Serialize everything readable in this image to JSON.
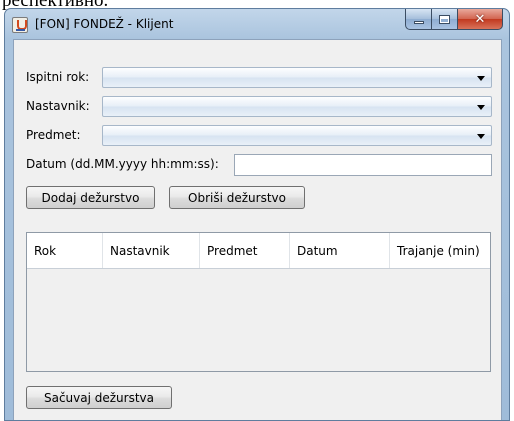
{
  "page_top_text": "респективно.",
  "window": {
    "title": "[FON] FONDEŽ - Klijent",
    "controls": {
      "minimize": "minimize-icon",
      "maximize": "maximize-icon",
      "close_glyph": "✕"
    }
  },
  "form": {
    "exam_period_label": "Ispitni rok:",
    "exam_period_value": "",
    "teacher_label": "Nastavnik:",
    "teacher_value": "",
    "subject_label": "Predmet:",
    "subject_value": "",
    "date_label": "Datum (dd.MM.yyyy hh:mm:ss):",
    "date_value": ""
  },
  "buttons": {
    "add_duty": "Dodaj dežurstvo",
    "delete_duty": "Obriši dežurstvo",
    "save_duties": "Sačuvaj dežurstva"
  },
  "table": {
    "columns": [
      "Rok",
      "Nastavnik",
      "Predmet",
      "Datum",
      "Trajanje (min)"
    ],
    "rows": []
  },
  "colors": {
    "title_bar": "#aac4de",
    "client_bg": "#f0f0f0",
    "close_button": "#c2391f"
  }
}
